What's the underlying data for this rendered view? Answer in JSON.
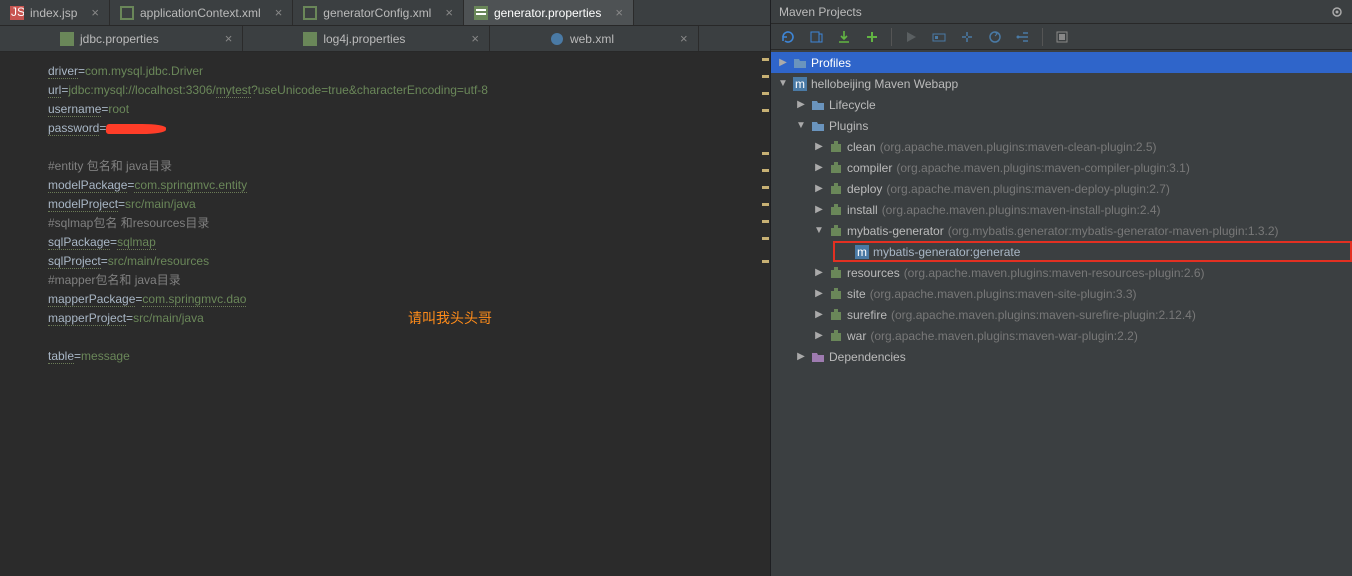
{
  "tabs_row1": [
    {
      "label": "index.jsp",
      "active": false
    },
    {
      "label": "applicationContext.xml",
      "active": false
    },
    {
      "label": "generatorConfig.xml",
      "active": false
    },
    {
      "label": "generator.properties",
      "active": true
    }
  ],
  "tabs_row2": [
    {
      "label": "jdbc.properties",
      "active": false
    },
    {
      "label": "log4j.properties",
      "active": false
    },
    {
      "label": "web.xml",
      "active": false
    }
  ],
  "editor": {
    "l1_key": "driver",
    "l1_val": "com.mysql.jdbc.Driver",
    "l2_key": "url",
    "l2_val_a": "jdbc:mysql://localhost:3306/",
    "l2_val_b": "mytest",
    "l2_val_c": "?useUnicode=true&characterEncoding=utf-8",
    "l3_key": "username",
    "l3_val": "root",
    "l4_key": "password",
    "c1": "#entity 包名和 java目录",
    "l5_key": "modelPackage",
    "l5_val": "com.springmvc.entity",
    "l6_key": "modelProject",
    "l6_val": "src/main/java",
    "c2": "#sqlmap包名 和resources目录",
    "l7_key": "sqlPackage",
    "l7_val": "sqlmap",
    "l8_key": "sqlProject",
    "l8_val": "src/main/resources",
    "c3": "#mapper包名和 java目录",
    "l9_key": "mapperPackage",
    "l9_val": "com.springmvc.dao",
    "l10_key": "mapperProject",
    "l10_val": "src/main/java",
    "l11_key": "table",
    "l11_val": "message"
  },
  "watermark": "请叫我头头哥",
  "panel": {
    "title": "Maven Projects",
    "profiles": "Profiles",
    "root": "hellobeijing Maven Webapp",
    "lifecycle": "Lifecycle",
    "plugins_label": "Plugins",
    "deps": "Dependencies",
    "plugins": [
      {
        "name": "clean",
        "detail": "(org.apache.maven.plugins:maven-clean-plugin:2.5)"
      },
      {
        "name": "compiler",
        "detail": "(org.apache.maven.plugins:maven-compiler-plugin:3.1)"
      },
      {
        "name": "deploy",
        "detail": "(org.apache.maven.plugins:maven-deploy-plugin:2.7)"
      },
      {
        "name": "install",
        "detail": "(org.apache.maven.plugins:maven-install-plugin:2.4)"
      },
      {
        "name": "mybatis-generator",
        "detail": "(org.mybatis.generator:mybatis-generator-maven-plugin:1.3.2)",
        "expanded": true,
        "goal": "mybatis-generator:generate"
      },
      {
        "name": "resources",
        "detail": "(org.apache.maven.plugins:maven-resources-plugin:2.6)"
      },
      {
        "name": "site",
        "detail": "(org.apache.maven.plugins:maven-site-plugin:3.3)"
      },
      {
        "name": "surefire",
        "detail": "(org.apache.maven.plugins:maven-surefire-plugin:2.12.4)"
      },
      {
        "name": "war",
        "detail": "(org.apache.maven.plugins:maven-war-plugin:2.2)"
      }
    ]
  }
}
